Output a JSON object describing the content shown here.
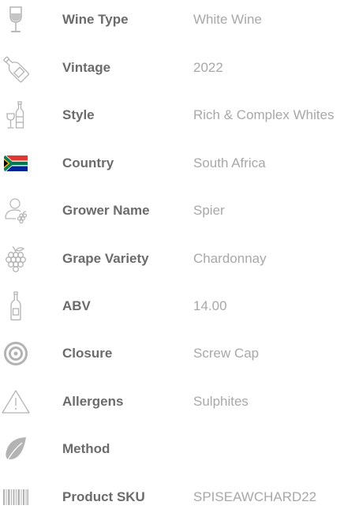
{
  "colors": {
    "label": "#6b6b6b",
    "value": "#a8a8a8",
    "icon": "#b3b3b3",
    "flag_green": "#007a4d",
    "flag_red": "#de3831",
    "flag_blue": "#002395",
    "flag_gold": "#ffb612"
  },
  "specs": [
    {
      "icon": "wine-glass-icon",
      "label": "Wine Type",
      "value": "White Wine"
    },
    {
      "icon": "wine-bottle-icon",
      "label": "Vintage",
      "value": "2022"
    },
    {
      "icon": "glass-and-bottle-icon",
      "label": "Style",
      "value": "Rich & Complex Whites"
    },
    {
      "icon": "south-africa-flag-icon",
      "label": "Country",
      "value": "South Africa"
    },
    {
      "icon": "grower-icon",
      "label": "Grower Name",
      "value": "Spier"
    },
    {
      "icon": "grape-icon",
      "label": "Grape Variety",
      "value": "Chardonnay"
    },
    {
      "icon": "bottle-outline-icon",
      "label": "ABV",
      "value": "14.00"
    },
    {
      "icon": "target-icon",
      "label": "Closure",
      "value": "Screw Cap"
    },
    {
      "icon": "warning-triangle-icon",
      "label": "Allergens",
      "value": "Sulphites"
    },
    {
      "icon": "leaf-icon",
      "label": "Method",
      "value": ""
    },
    {
      "icon": "barcode-icon",
      "label": "Product SKU",
      "value": "SPISEAWCHARD22"
    }
  ]
}
